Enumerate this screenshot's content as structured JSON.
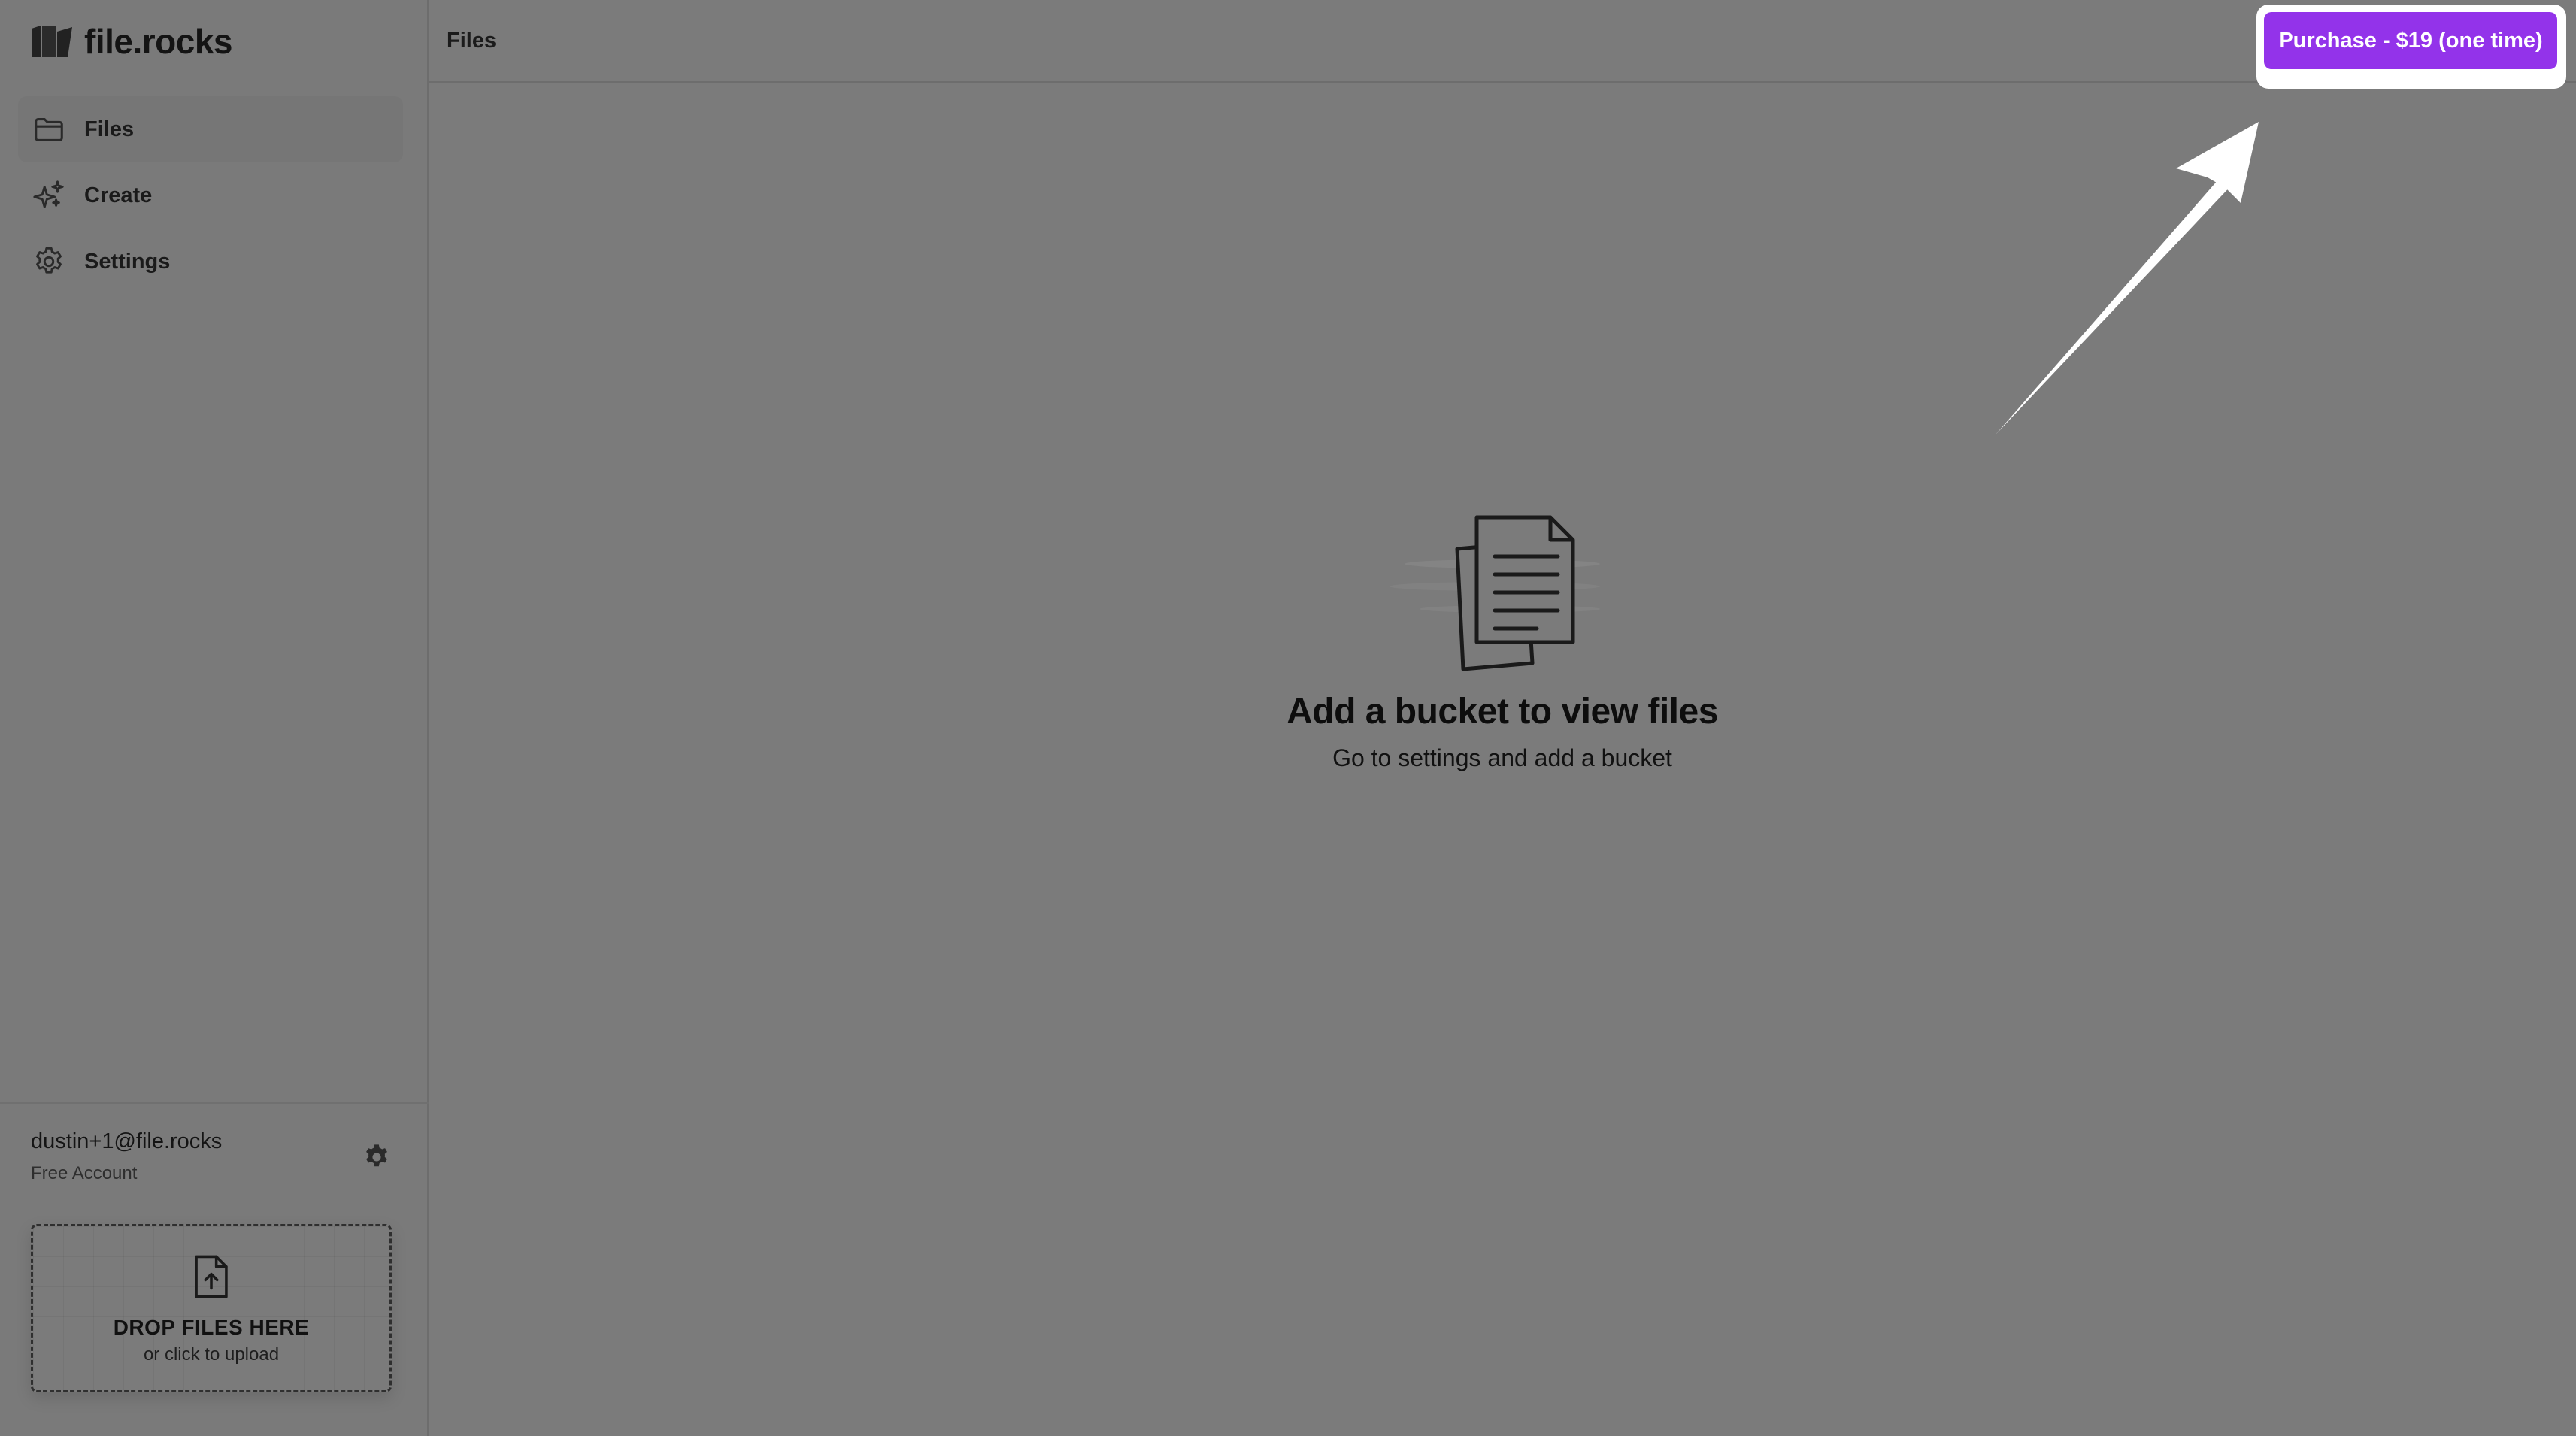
{
  "app": {
    "name": "file.rocks"
  },
  "sidebar": {
    "items": [
      {
        "label": "Files",
        "icon": "folder-icon",
        "active": true
      },
      {
        "label": "Create",
        "icon": "sparkles-icon",
        "active": false
      },
      {
        "label": "Settings",
        "icon": "gear-icon",
        "active": false
      }
    ],
    "account": {
      "email": "dustin+1@file.rocks",
      "plan": "Free Account",
      "settings_icon": "gear-icon"
    },
    "dropzone": {
      "icon": "file-upload-icon",
      "title": "DROP FILES HERE",
      "subtitle": "or click to upload"
    }
  },
  "header": {
    "breadcrumb": "Files",
    "purchase_label": "Purchase - $19 (one time)"
  },
  "empty_state": {
    "icon": "documents-icon",
    "title": "Add a bucket to view files",
    "subtitle": "Go to settings and add a bucket"
  },
  "colors": {
    "accent": "#9333ea",
    "overlay": "#7b7b7b",
    "highlight": "#ffffff"
  }
}
